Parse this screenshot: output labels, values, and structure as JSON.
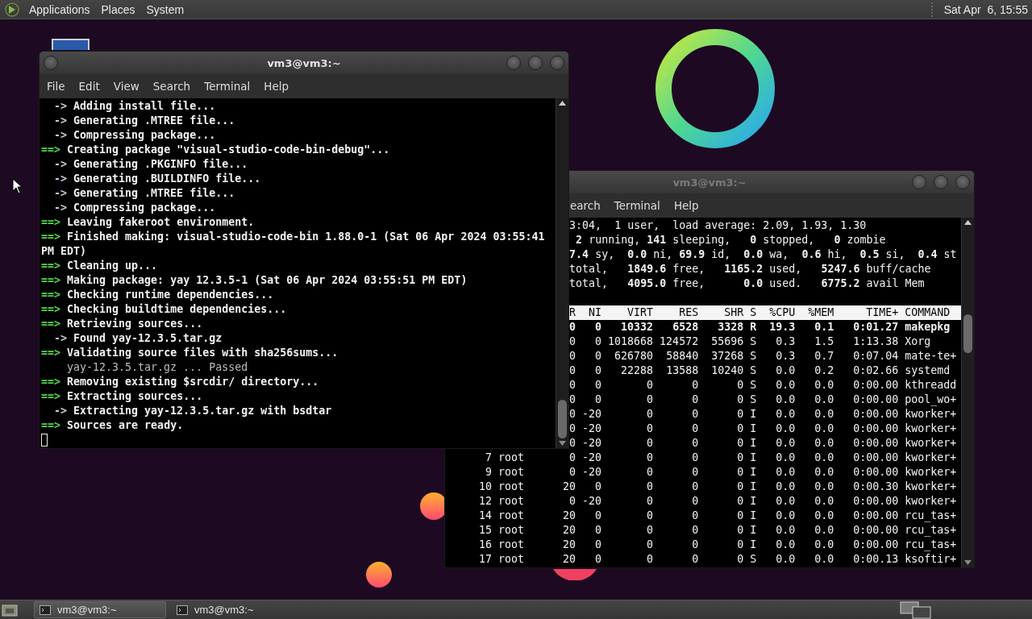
{
  "top_panel": {
    "menus": [
      "Applications",
      "Places",
      "System"
    ],
    "clock": "Sat Apr  6, 15:55"
  },
  "top_terminal": {
    "title": "vm3@vm3:~",
    "active": false,
    "menus": [
      "earch",
      "Terminal",
      "Help"
    ],
    "summary": [
      "3:04,  1 user,  load average: 2.09, 1.93, 1.30",
      " **2** running, **141** sleeping,   **0** stopped,   **0** zombie",
      "**7.4** sy,  **0.0** ni, **69.9** id,  **0.0** wa,  **0.6** hi,  **0.5** si,  **0.4** st",
      "total,   **1849.6** free,   **1165.2** used,   **5247.6** buff/cache",
      "total,   **4095.0** free,      **0.0** used.   **6775.2** avail Mem"
    ],
    "header": {
      "pr": "R",
      "ni": "NI",
      "virt": "VIRT",
      "res": "RES",
      "shr": "SHR",
      "s": "S",
      "cpu": "%CPU",
      "mem": "%MEM",
      "time": "TIME+",
      "cmd": "COMMAND"
    },
    "processes": [
      {
        "pr": "0",
        "ni": "0",
        "virt": "10332",
        "res": "6528",
        "shr": "3328",
        "s": "R",
        "cpu": "19.3",
        "mem": "0.1",
        "time": "0:01.27",
        "cmd": "makepkg",
        "highlighted": true
      },
      {
        "pr": "0",
        "ni": "0",
        "virt": "1018668",
        "res": "124572",
        "shr": "55696",
        "s": "S",
        "cpu": "0.3",
        "mem": "1.5",
        "time": "1:13.38",
        "cmd": "Xorg",
        "highlighted": false
      },
      {
        "pr": "0",
        "ni": "0",
        "virt": "626780",
        "res": "58840",
        "shr": "37268",
        "s": "S",
        "cpu": "0.3",
        "mem": "0.7",
        "time": "0:07.04",
        "cmd": "mate-te+",
        "highlighted": false
      },
      {
        "pr": "0",
        "ni": "0",
        "virt": "22288",
        "res": "13588",
        "shr": "10240",
        "s": "S",
        "cpu": "0.0",
        "mem": "0.2",
        "time": "0:02.66",
        "cmd": "systemd",
        "highlighted": false
      },
      {
        "pr": "0",
        "ni": "0",
        "virt": "0",
        "res": "0",
        "shr": "0",
        "s": "S",
        "cpu": "0.0",
        "mem": "0.0",
        "time": "0:00.00",
        "cmd": "kthreadd",
        "highlighted": false
      },
      {
        "pr": "0",
        "ni": "0",
        "virt": "0",
        "res": "0",
        "shr": "0",
        "s": "S",
        "cpu": "0.0",
        "mem": "0.0",
        "time": "0:00.00",
        "cmd": "pool_wo+",
        "highlighted": false
      },
      {
        "pr": "0",
        "ni": "-20",
        "virt": "0",
        "res": "0",
        "shr": "0",
        "s": "I",
        "cpu": "0.0",
        "mem": "0.0",
        "time": "0:00.00",
        "cmd": "kworker+",
        "highlighted": false
      },
      {
        "pr": "0",
        "ni": "-20",
        "virt": "0",
        "res": "0",
        "shr": "0",
        "s": "I",
        "cpu": "0.0",
        "mem": "0.0",
        "time": "0:00.00",
        "cmd": "kworker+",
        "highlighted": false
      },
      {
        "pr": "0",
        "ni": "-20",
        "virt": "0",
        "res": "0",
        "shr": "0",
        "s": "I",
        "cpu": "0.0",
        "mem": "0.0",
        "time": "0:00.00",
        "cmd": "kworker+",
        "highlighted": false
      },
      {
        "pid": "7",
        "user": "root",
        "pr": "0",
        "ni": "-20",
        "virt": "0",
        "res": "0",
        "shr": "0",
        "s": "I",
        "cpu": "0.0",
        "mem": "0.0",
        "time": "0:00.00",
        "cmd": "kworker+",
        "highlighted": false
      },
      {
        "pid": "9",
        "user": "root",
        "pr": "0",
        "ni": "-20",
        "virt": "0",
        "res": "0",
        "shr": "0",
        "s": "I",
        "cpu": "0.0",
        "mem": "0.0",
        "time": "0:00.00",
        "cmd": "kworker+",
        "highlighted": false
      },
      {
        "pid": "10",
        "user": "root",
        "pr": "20",
        "ni": "0",
        "virt": "0",
        "res": "0",
        "shr": "0",
        "s": "I",
        "cpu": "0.0",
        "mem": "0.0",
        "time": "0:00.30",
        "cmd": "kworker+",
        "highlighted": false
      },
      {
        "pid": "12",
        "user": "root",
        "pr": "0",
        "ni": "-20",
        "virt": "0",
        "res": "0",
        "shr": "0",
        "s": "I",
        "cpu": "0.0",
        "mem": "0.0",
        "time": "0:00.00",
        "cmd": "kworker+",
        "highlighted": false
      },
      {
        "pid": "14",
        "user": "root",
        "pr": "20",
        "ni": "0",
        "virt": "0",
        "res": "0",
        "shr": "0",
        "s": "I",
        "cpu": "0.0",
        "mem": "0.0",
        "time": "0:00.00",
        "cmd": "rcu_tas+",
        "highlighted": false
      },
      {
        "pid": "15",
        "user": "root",
        "pr": "20",
        "ni": "0",
        "virt": "0",
        "res": "0",
        "shr": "0",
        "s": "I",
        "cpu": "0.0",
        "mem": "0.0",
        "time": "0:00.00",
        "cmd": "rcu_tas+",
        "highlighted": false
      },
      {
        "pid": "16",
        "user": "root",
        "pr": "20",
        "ni": "0",
        "virt": "0",
        "res": "0",
        "shr": "0",
        "s": "I",
        "cpu": "0.0",
        "mem": "0.0",
        "time": "0:00.00",
        "cmd": "rcu_tas+",
        "highlighted": false
      },
      {
        "pid": "17",
        "user": "root",
        "pr": "20",
        "ni": "0",
        "virt": "0",
        "res": "0",
        "shr": "0",
        "s": "S",
        "cpu": "0.0",
        "mem": "0.0",
        "time": "0:00.13",
        "cmd": "ksoftir+",
        "highlighted": false
      }
    ]
  },
  "build_terminal": {
    "title": "vm3@vm3:~",
    "active": true,
    "menus": [
      "File",
      "Edit",
      "View",
      "Search",
      "Terminal",
      "Help"
    ],
    "lines": [
      {
        "kind": "substep",
        "marker": "->",
        "text": "Adding install file..."
      },
      {
        "kind": "substep",
        "marker": "->",
        "text": "Generating .MTREE file..."
      },
      {
        "kind": "substep",
        "marker": "->",
        "text": "Compressing package..."
      },
      {
        "kind": "step",
        "marker": "==>",
        "text": "Creating package \"visual-studio-code-bin-debug\"..."
      },
      {
        "kind": "substep",
        "marker": "->",
        "text": "Generating .PKGINFO file..."
      },
      {
        "kind": "substep",
        "marker": "->",
        "text": "Generating .BUILDINFO file..."
      },
      {
        "kind": "substep",
        "marker": "->",
        "text": "Generating .MTREE file..."
      },
      {
        "kind": "substep",
        "marker": "->",
        "text": "Compressing package..."
      },
      {
        "kind": "step",
        "marker": "==>",
        "text": "Leaving fakeroot environment."
      },
      {
        "kind": "step",
        "marker": "==>",
        "text": "Finished making: visual-studio-code-bin 1.88.0-1 (Sat 06 Apr 2024 03:55:41 PM EDT)"
      },
      {
        "kind": "step",
        "marker": "==>",
        "text": "Cleaning up..."
      },
      {
        "kind": "step",
        "marker": "==>",
        "text": "Making package: yay 12.3.5-1 (Sat 06 Apr 2024 03:55:51 PM EDT)"
      },
      {
        "kind": "step",
        "marker": "==>",
        "text": "Checking runtime dependencies..."
      },
      {
        "kind": "step",
        "marker": "==>",
        "text": "Checking buildtime dependencies..."
      },
      {
        "kind": "step",
        "marker": "==>",
        "text": "Retrieving sources..."
      },
      {
        "kind": "substep",
        "marker": "->",
        "text": "Found yay-12.3.5.tar.gz"
      },
      {
        "kind": "step",
        "marker": "==>",
        "text": "Validating source files with sha256sums..."
      },
      {
        "kind": "plain",
        "text": "yay-12.3.5.tar.gz ... Passed"
      },
      {
        "kind": "step",
        "marker": "==>",
        "text": "Removing existing $srcdir/ directory..."
      },
      {
        "kind": "step",
        "marker": "==>",
        "text": "Extracting sources..."
      },
      {
        "kind": "substep",
        "marker": "->",
        "text": "Extracting yay-12.3.5.tar.gz with bsdtar"
      },
      {
        "kind": "step",
        "marker": "==>",
        "text": "Sources are ready."
      }
    ]
  },
  "taskbar": {
    "tasks": [
      {
        "label": "vm3@vm3:~",
        "selected": true
      },
      {
        "label": "vm3@vm3:~",
        "selected": false
      }
    ]
  }
}
